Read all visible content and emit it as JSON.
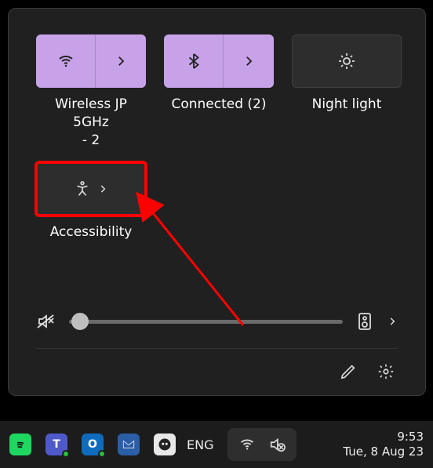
{
  "tiles": {
    "wifi": {
      "label": "Wireless JP 5GHz\n- 2"
    },
    "bluetooth": {
      "label": "Connected (2)"
    },
    "nightlight": {
      "label": "Night light"
    },
    "accessibility": {
      "label": "Accessibility"
    }
  },
  "volume": {
    "muted": true,
    "value": 4
  },
  "taskbar": {
    "language": "ENG",
    "clock_time": "9:53",
    "clock_date": "Tue, 8 Aug 23"
  }
}
